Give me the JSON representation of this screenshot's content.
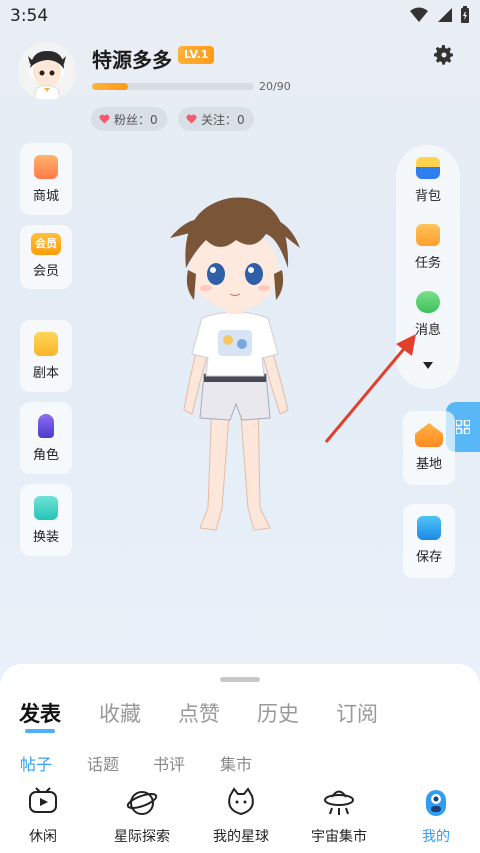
{
  "status": {
    "time": "3:54"
  },
  "profile": {
    "name": "特源多多",
    "level": "LV.1",
    "xp_text": "20/90",
    "xp_progress": 0.2222,
    "fans": "粉丝：0",
    "follows": "关注：0"
  },
  "left_menu": [
    {
      "label": "商城",
      "icon": "shopping-bag-icon"
    },
    {
      "label": "会员",
      "icon": "crown-icon",
      "badge": "会员"
    },
    {
      "label": "剧本",
      "icon": "script-book-icon"
    },
    {
      "label": "角色",
      "icon": "character-icon"
    },
    {
      "label": "换装",
      "icon": "outfit-icon"
    }
  ],
  "right_menu": [
    {
      "label": "背包",
      "icon": "backpack-icon"
    },
    {
      "label": "任务",
      "icon": "task-icon"
    },
    {
      "label": "消息",
      "icon": "message-icon"
    }
  ],
  "right_extra": [
    {
      "label": "基地",
      "icon": "home-base-icon"
    },
    {
      "label": "保存",
      "icon": "save-icon"
    }
  ],
  "tabs_main": [
    "发表",
    "收藏",
    "点赞",
    "历史",
    "订阅"
  ],
  "tabs_sub": [
    "帖子",
    "话题",
    "书评",
    "集市"
  ],
  "bottom_nav": [
    {
      "label": "休闲",
      "icon": "tv-icon"
    },
    {
      "label": "星际探索",
      "icon": "planet-icon"
    },
    {
      "label": "我的星球",
      "icon": "cat-planet-icon"
    },
    {
      "label": "宇宙集市",
      "icon": "ufo-icon"
    },
    {
      "label": "我的",
      "icon": "profile-icon"
    }
  ],
  "colors": {
    "accent": "#36a2f0",
    "level": "#ff9c1a",
    "arrow": "#e0402c"
  }
}
